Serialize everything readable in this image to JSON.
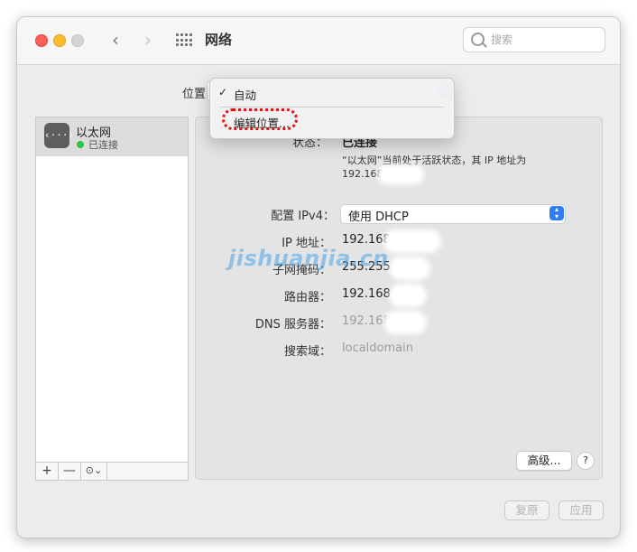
{
  "window": {
    "title": "网络",
    "search_placeholder": "搜索"
  },
  "location": {
    "label": "位置：",
    "menu": {
      "check": "✓",
      "auto": "自动",
      "edit": "编辑位置..."
    }
  },
  "sidebar": {
    "items": [
      {
        "name": "以太网",
        "status": "已连接",
        "icon_glyph": "‹···›"
      }
    ],
    "add": "+",
    "remove": "—",
    "more": "⊙⌄"
  },
  "detail": {
    "status_label": "状态：",
    "status_value": "已连接",
    "status_desc_line1": "“以太网”当前处于活跃状态，其 IP 地址为",
    "status_desc_line2": "192.168",
    "ipv4_label": "配置 IPv4：",
    "ipv4_value": "使用 DHCP",
    "ip_label": "IP 地址：",
    "ip_value": "192.168",
    "subnet_label": "子网掩码：",
    "subnet_value": "255.255.",
    "router_label": "路由器：",
    "router_value": "192.168",
    "dns_label": "DNS 服务器：",
    "dns_value": "192.168",
    "search_domain_label": "搜索域：",
    "search_domain_value": "localdomain",
    "advanced": "高级...",
    "help": "?"
  },
  "footer": {
    "revert": "复原",
    "apply": "应用"
  },
  "watermark": "jishuanjia.cn",
  "colors": {
    "accent": "#2f7cf6",
    "status_green": "#2ec04a",
    "highlight": "#e01313"
  }
}
